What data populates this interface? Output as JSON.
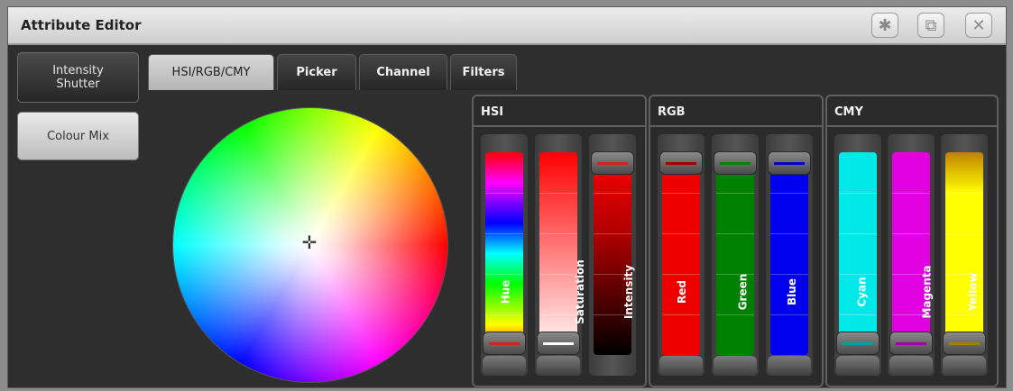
{
  "window": {
    "title": "Attribute Editor",
    "buttons": [
      {
        "name": "settings",
        "icon": "gear-icon",
        "glyph": "✱"
      },
      {
        "name": "screenshot",
        "icon": "frame-icon",
        "glyph": "⧉"
      },
      {
        "name": "close",
        "icon": "close-icon",
        "glyph": "✕"
      }
    ]
  },
  "sidebar": {
    "items": [
      {
        "label": "Intensity Shutter",
        "active": false
      },
      {
        "label": "Colour Mix",
        "active": true
      }
    ]
  },
  "tabs": [
    {
      "label": "HSI/RGB/CMY",
      "active": true
    },
    {
      "label": "Picker",
      "active": false
    },
    {
      "label": "Channel",
      "active": false
    },
    {
      "label": "Filters",
      "active": false
    }
  ],
  "picker": {
    "icon": "crosshair-icon",
    "glyph": "✛"
  },
  "panels": {
    "hsi": {
      "title": "HSI",
      "faders": [
        {
          "label": "Hue",
          "level": 0.05,
          "knob_line": "#d02020"
        },
        {
          "label": "Saturation",
          "level": 0.05,
          "knob_line": "#ffffff"
        },
        {
          "label": "Intensity",
          "level": 0.95,
          "knob_line": "#d02020"
        }
      ]
    },
    "rgb": {
      "title": "RGB",
      "faders": [
        {
          "label": "Red",
          "level": 0.95,
          "knob_line": "#a00000"
        },
        {
          "label": "Green",
          "level": 0.95,
          "knob_line": "#008000"
        },
        {
          "label": "Blue",
          "level": 0.95,
          "knob_line": "#0000c0"
        }
      ]
    },
    "cmy": {
      "title": "CMY",
      "faders": [
        {
          "label": "Cyan",
          "level": 0.05,
          "knob_line": "#00a0a0"
        },
        {
          "label": "Magenta",
          "level": 0.05,
          "knob_line": "#a000a0"
        },
        {
          "label": "Yellow",
          "level": 0.05,
          "knob_line": "#a08000"
        }
      ]
    }
  },
  "colors": {
    "hue_gradient": "linear-gradient(#ff0000,#ff00ff 15%,#0000ff 35%,#00ffff 50%,#00ff00 65%,#ffff00 85%,#ff0000)",
    "saturation_gradient": "linear-gradient(#ff0000,#ff8080 50%,#ffffff)",
    "intensity_gradient": "linear-gradient(#ff0000,#b00000 40%,#000000)",
    "red": "#ee0000",
    "green": "#008000",
    "blue": "#0000ee",
    "cyan": "#00e8e8",
    "magenta": "#e000e0",
    "yellow_gradient": "linear-gradient(#c08000,#e0c000 10%,#ffff00 20%,#ffff00)"
  }
}
